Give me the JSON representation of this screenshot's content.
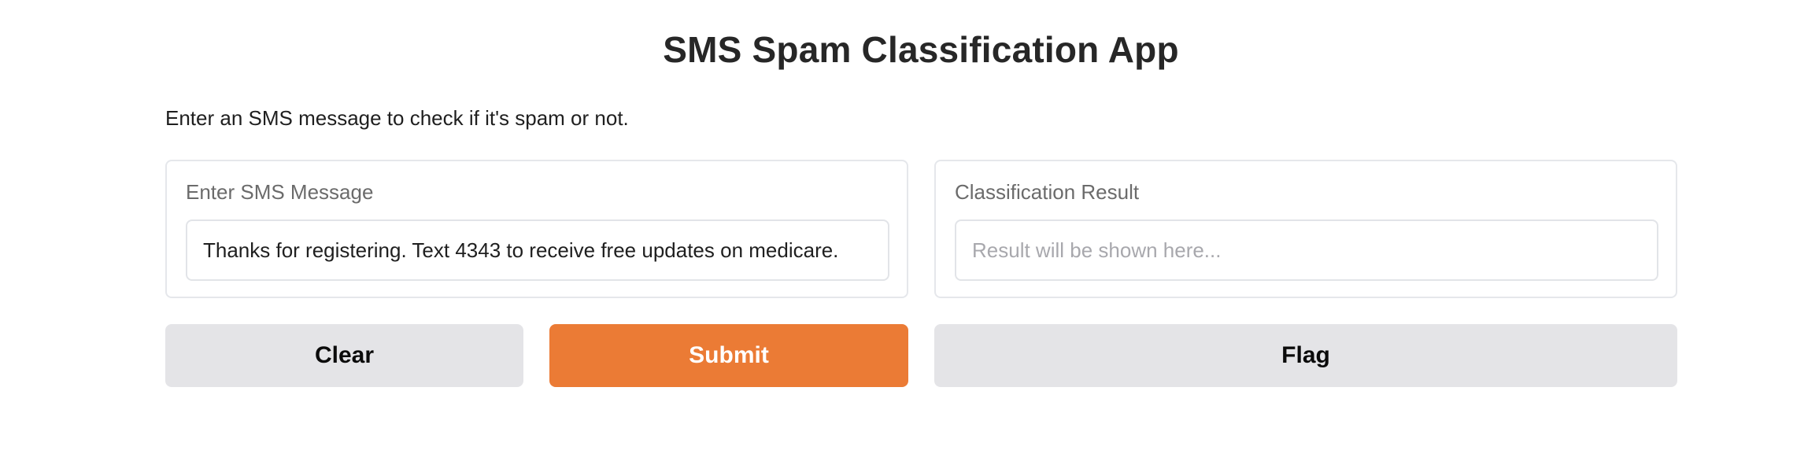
{
  "app": {
    "title": "SMS Spam Classification App",
    "description": "Enter an SMS message to check if it's spam or not."
  },
  "input_panel": {
    "label": "Enter SMS Message",
    "value": "Thanks for registering. Text 4343 to receive free updates on medicare."
  },
  "output_panel": {
    "label": "Classification Result",
    "value": "",
    "placeholder": "Result will be shown here..."
  },
  "buttons": {
    "clear_label": "Clear",
    "submit_label": "Submit",
    "flag_label": "Flag"
  },
  "colors": {
    "submit_bg": "#eb7b35",
    "secondary_bg": "#e4e4e7",
    "border": "#e5e7eb"
  }
}
